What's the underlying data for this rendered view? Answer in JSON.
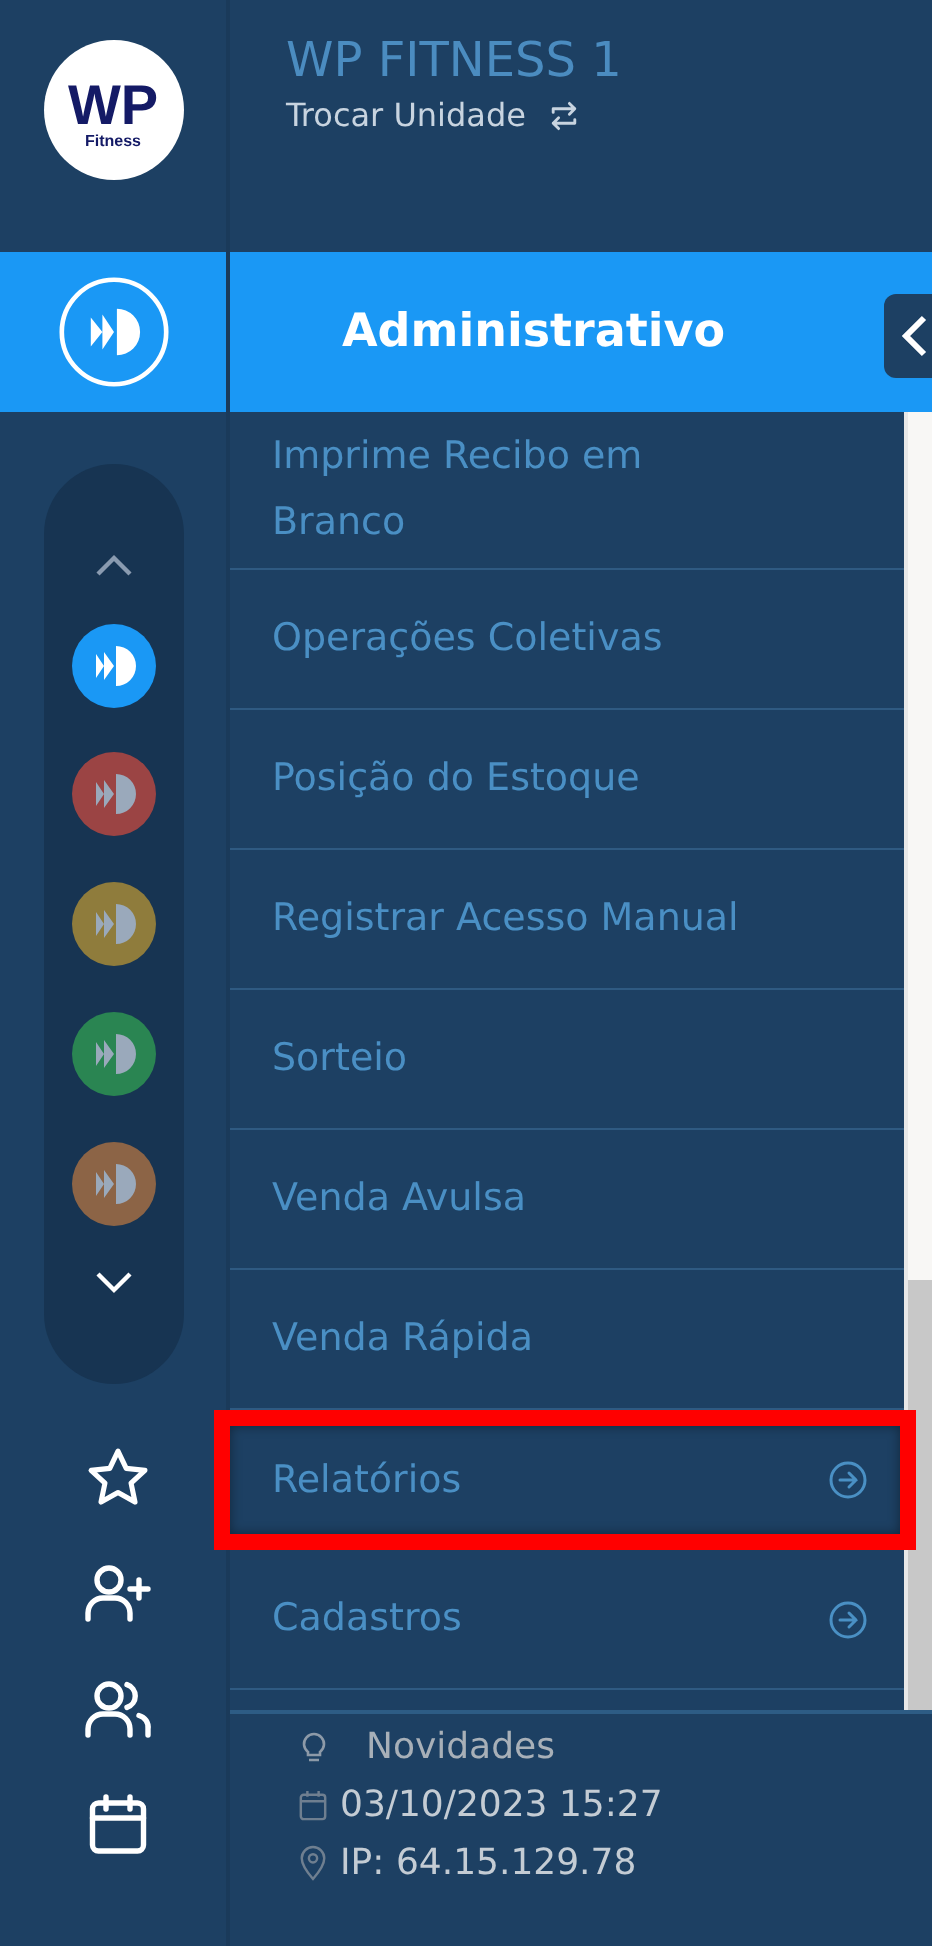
{
  "logo": {
    "title": "WP",
    "subtitle": "Fitness"
  },
  "header": {
    "unit_name": "WP FITNESS 1",
    "switch_label": "Trocar Unidade"
  },
  "section": {
    "title": "Administrativo"
  },
  "modules": [
    {
      "color": "#1a98f5",
      "selected": true
    },
    {
      "color": "#9b4444",
      "selected": false
    },
    {
      "color": "#8f7c3c",
      "selected": false
    },
    {
      "color": "#2a8552",
      "selected": false
    },
    {
      "color": "#8c6446",
      "selected": false
    }
  ],
  "rail_actions": [
    {
      "kind": "star"
    },
    {
      "kind": "add-user"
    },
    {
      "kind": "users"
    },
    {
      "kind": "calendar"
    }
  ],
  "menu": [
    {
      "label": "Imprime Recibo em Branco",
      "kind": "link",
      "highlighted": false
    },
    {
      "label": "Operações Coletivas",
      "kind": "link",
      "highlighted": false
    },
    {
      "label": "Posição do Estoque",
      "kind": "link",
      "highlighted": false
    },
    {
      "label": "Registrar Acesso Manual",
      "kind": "link",
      "highlighted": false
    },
    {
      "label": "Sorteio",
      "kind": "link",
      "highlighted": false
    },
    {
      "label": "Venda Avulsa",
      "kind": "link",
      "highlighted": false
    },
    {
      "label": "Venda Rápida",
      "kind": "link",
      "highlighted": false
    },
    {
      "label": "Relatórios",
      "kind": "submenu",
      "highlighted": true
    },
    {
      "label": "Cadastros",
      "kind": "submenu",
      "highlighted": false
    }
  ],
  "footer": {
    "news": "Novidades",
    "datetime": "03/10/2023 15:27",
    "ip": "IP: 64.15.129.78"
  }
}
